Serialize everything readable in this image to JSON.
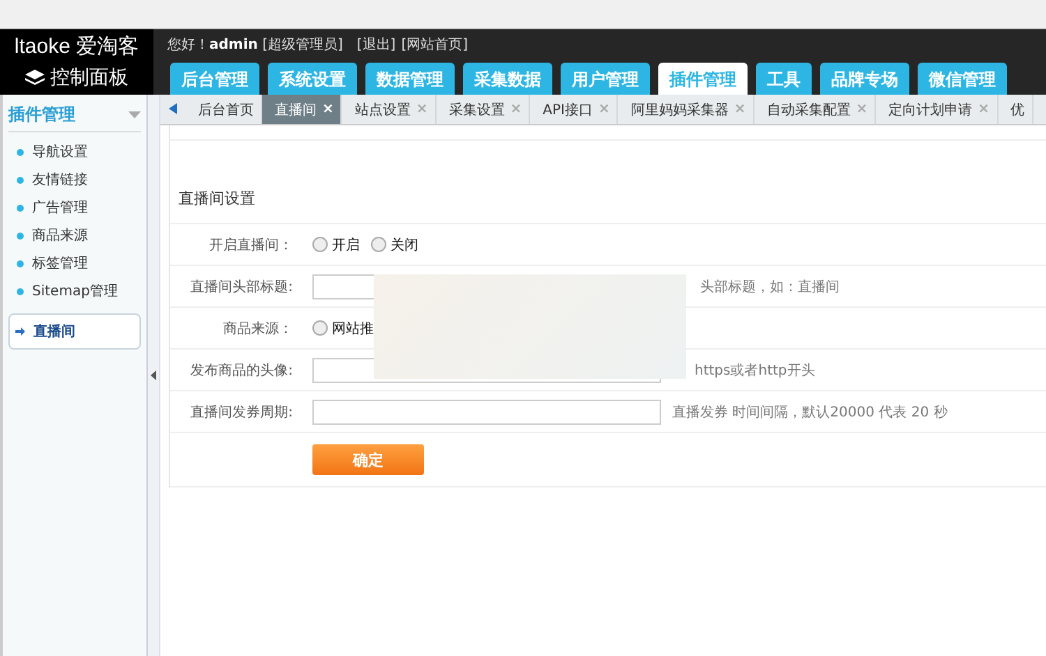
{
  "header": {
    "logo": "ltaoke",
    "logo_cn": "爱淘客",
    "panel_title": "控制面板",
    "greeting": "您好！",
    "user": "admin",
    "role": "[超级管理员]",
    "links": [
      "[退出]",
      "[网站首页]"
    ]
  },
  "nav_tabs": [
    {
      "label": "后台管理",
      "selected": false
    },
    {
      "label": "系统设置",
      "selected": false
    },
    {
      "label": "数据管理",
      "selected": false
    },
    {
      "label": "采集数据",
      "selected": false
    },
    {
      "label": "用户管理",
      "selected": false
    },
    {
      "label": "插件管理",
      "selected": true
    },
    {
      "label": "工具",
      "selected": false
    },
    {
      "label": "品牌专场",
      "selected": false
    },
    {
      "label": "微信管理",
      "selected": false
    }
  ],
  "sidebar": {
    "title": "插件管理",
    "items": [
      {
        "label": "导航设置",
        "selected": false
      },
      {
        "label": "友情链接",
        "selected": false
      },
      {
        "label": "广告管理",
        "selected": false
      },
      {
        "label": "商品来源",
        "selected": false
      },
      {
        "label": "标签管理",
        "selected": false
      },
      {
        "label": "Sitemap管理",
        "selected": false
      },
      {
        "label": "直播间",
        "selected": true
      }
    ]
  },
  "page_tabs": [
    {
      "label": "后台首页",
      "selected": false,
      "closable": false
    },
    {
      "label": "直播间",
      "selected": true,
      "closable": true
    },
    {
      "label": "站点设置",
      "selected": false,
      "closable": true
    },
    {
      "label": "采集设置",
      "selected": false,
      "closable": true
    },
    {
      "label": "API接口",
      "selected": false,
      "closable": true
    },
    {
      "label": "阿里妈妈采集器",
      "selected": false,
      "closable": true
    },
    {
      "label": "自动采集配置",
      "selected": false,
      "closable": true
    },
    {
      "label": "定向计划申请",
      "selected": false,
      "closable": true
    },
    {
      "label": "优",
      "selected": false,
      "closable": false
    }
  ],
  "close_glyph": "×",
  "form": {
    "title": "直播间设置",
    "rows": [
      {
        "kind": "radio",
        "label": "开启直播间：",
        "options": [
          {
            "label": "开启",
            "checked": false
          },
          {
            "label": "关闭",
            "checked": false
          }
        ]
      },
      {
        "kind": "text",
        "label": "直播间头部标题:",
        "hint": "头部标题，如：直播间"
      },
      {
        "kind": "radio",
        "label": "商品来源：",
        "options": [
          {
            "label": "网站推",
            "checked": false
          }
        ]
      },
      {
        "kind": "text",
        "label": "发布商品的头像:",
        "hint": "https或者http开头"
      },
      {
        "kind": "text",
        "label": "直播间发券周期:",
        "hint": "直播发券 时间间隔，默认20000 代表 20 秒"
      }
    ],
    "submit": "确定"
  }
}
